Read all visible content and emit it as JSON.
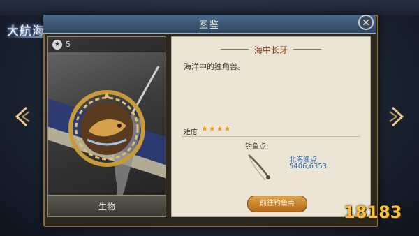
{
  "game_logo": "大航海之路",
  "dialog": {
    "title": "图鉴",
    "close_icon": "close-icon"
  },
  "creature_card": {
    "star_rank": "5",
    "category_label": "生物"
  },
  "details": {
    "name": "海中长牙",
    "description": "海洋中的独角兽。",
    "difficulty_label": "难度",
    "difficulty_stars": "★★★★",
    "difficulty_value": 4,
    "fishing_spot_title": "钓鱼点:",
    "fishing_spot_name": "北海渔点",
    "fishing_spot_coords": "5406,6353",
    "go_button": "前往钓鱼点"
  },
  "navigation": {
    "prev_icon": "chevron-left-icon",
    "next_icon": "chevron-right-icon"
  },
  "watermark": "18183",
  "colors": {
    "accent_gold": "#d9a21a",
    "title_bar": "#3d5875",
    "link_blue": "#2a66b8",
    "fish_name": "#7a3a12"
  }
}
